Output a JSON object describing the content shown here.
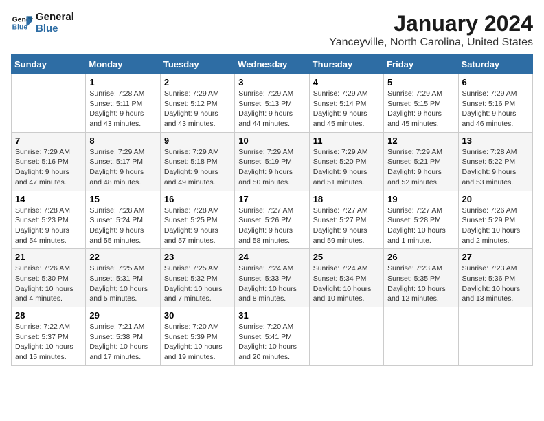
{
  "logo": {
    "line1": "General",
    "line2": "Blue"
  },
  "title": "January 2024",
  "subtitle": "Yanceyville, North Carolina, United States",
  "headers": [
    "Sunday",
    "Monday",
    "Tuesday",
    "Wednesday",
    "Thursday",
    "Friday",
    "Saturday"
  ],
  "weeks": [
    [
      {
        "num": "",
        "info": ""
      },
      {
        "num": "1",
        "info": "Sunrise: 7:28 AM\nSunset: 5:11 PM\nDaylight: 9 hours\nand 43 minutes."
      },
      {
        "num": "2",
        "info": "Sunrise: 7:29 AM\nSunset: 5:12 PM\nDaylight: 9 hours\nand 43 minutes."
      },
      {
        "num": "3",
        "info": "Sunrise: 7:29 AM\nSunset: 5:13 PM\nDaylight: 9 hours\nand 44 minutes."
      },
      {
        "num": "4",
        "info": "Sunrise: 7:29 AM\nSunset: 5:14 PM\nDaylight: 9 hours\nand 45 minutes."
      },
      {
        "num": "5",
        "info": "Sunrise: 7:29 AM\nSunset: 5:15 PM\nDaylight: 9 hours\nand 45 minutes."
      },
      {
        "num": "6",
        "info": "Sunrise: 7:29 AM\nSunset: 5:16 PM\nDaylight: 9 hours\nand 46 minutes."
      }
    ],
    [
      {
        "num": "7",
        "info": "Sunrise: 7:29 AM\nSunset: 5:16 PM\nDaylight: 9 hours\nand 47 minutes."
      },
      {
        "num": "8",
        "info": "Sunrise: 7:29 AM\nSunset: 5:17 PM\nDaylight: 9 hours\nand 48 minutes."
      },
      {
        "num": "9",
        "info": "Sunrise: 7:29 AM\nSunset: 5:18 PM\nDaylight: 9 hours\nand 49 minutes."
      },
      {
        "num": "10",
        "info": "Sunrise: 7:29 AM\nSunset: 5:19 PM\nDaylight: 9 hours\nand 50 minutes."
      },
      {
        "num": "11",
        "info": "Sunrise: 7:29 AM\nSunset: 5:20 PM\nDaylight: 9 hours\nand 51 minutes."
      },
      {
        "num": "12",
        "info": "Sunrise: 7:29 AM\nSunset: 5:21 PM\nDaylight: 9 hours\nand 52 minutes."
      },
      {
        "num": "13",
        "info": "Sunrise: 7:28 AM\nSunset: 5:22 PM\nDaylight: 9 hours\nand 53 minutes."
      }
    ],
    [
      {
        "num": "14",
        "info": "Sunrise: 7:28 AM\nSunset: 5:23 PM\nDaylight: 9 hours\nand 54 minutes."
      },
      {
        "num": "15",
        "info": "Sunrise: 7:28 AM\nSunset: 5:24 PM\nDaylight: 9 hours\nand 55 minutes."
      },
      {
        "num": "16",
        "info": "Sunrise: 7:28 AM\nSunset: 5:25 PM\nDaylight: 9 hours\nand 57 minutes."
      },
      {
        "num": "17",
        "info": "Sunrise: 7:27 AM\nSunset: 5:26 PM\nDaylight: 9 hours\nand 58 minutes."
      },
      {
        "num": "18",
        "info": "Sunrise: 7:27 AM\nSunset: 5:27 PM\nDaylight: 9 hours\nand 59 minutes."
      },
      {
        "num": "19",
        "info": "Sunrise: 7:27 AM\nSunset: 5:28 PM\nDaylight: 10 hours\nand 1 minute."
      },
      {
        "num": "20",
        "info": "Sunrise: 7:26 AM\nSunset: 5:29 PM\nDaylight: 10 hours\nand 2 minutes."
      }
    ],
    [
      {
        "num": "21",
        "info": "Sunrise: 7:26 AM\nSunset: 5:30 PM\nDaylight: 10 hours\nand 4 minutes."
      },
      {
        "num": "22",
        "info": "Sunrise: 7:25 AM\nSunset: 5:31 PM\nDaylight: 10 hours\nand 5 minutes."
      },
      {
        "num": "23",
        "info": "Sunrise: 7:25 AM\nSunset: 5:32 PM\nDaylight: 10 hours\nand 7 minutes."
      },
      {
        "num": "24",
        "info": "Sunrise: 7:24 AM\nSunset: 5:33 PM\nDaylight: 10 hours\nand 8 minutes."
      },
      {
        "num": "25",
        "info": "Sunrise: 7:24 AM\nSunset: 5:34 PM\nDaylight: 10 hours\nand 10 minutes."
      },
      {
        "num": "26",
        "info": "Sunrise: 7:23 AM\nSunset: 5:35 PM\nDaylight: 10 hours\nand 12 minutes."
      },
      {
        "num": "27",
        "info": "Sunrise: 7:23 AM\nSunset: 5:36 PM\nDaylight: 10 hours\nand 13 minutes."
      }
    ],
    [
      {
        "num": "28",
        "info": "Sunrise: 7:22 AM\nSunset: 5:37 PM\nDaylight: 10 hours\nand 15 minutes."
      },
      {
        "num": "29",
        "info": "Sunrise: 7:21 AM\nSunset: 5:38 PM\nDaylight: 10 hours\nand 17 minutes."
      },
      {
        "num": "30",
        "info": "Sunrise: 7:20 AM\nSunset: 5:39 PM\nDaylight: 10 hours\nand 19 minutes."
      },
      {
        "num": "31",
        "info": "Sunrise: 7:20 AM\nSunset: 5:41 PM\nDaylight: 10 hours\nand 20 minutes."
      },
      {
        "num": "",
        "info": ""
      },
      {
        "num": "",
        "info": ""
      },
      {
        "num": "",
        "info": ""
      }
    ]
  ]
}
